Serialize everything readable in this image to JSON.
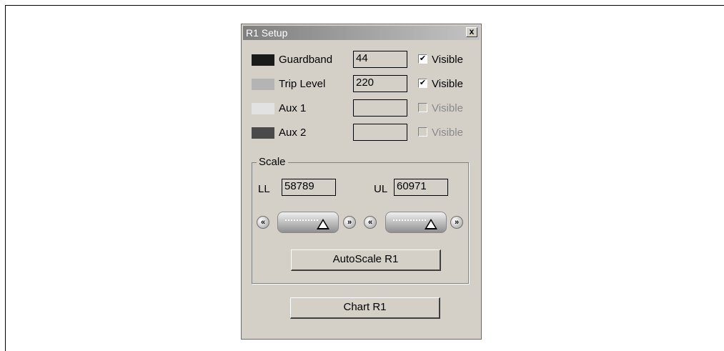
{
  "dialog": {
    "title": "R1 Setup",
    "close_glyph": "x"
  },
  "levels": [
    {
      "label": "Guardband",
      "color": "#1a1a1a",
      "value": "44",
      "visible_label": "Visible",
      "checked": true,
      "enabled": true
    },
    {
      "label": "Trip Level",
      "color": "#b4b4b4",
      "value": "220",
      "visible_label": "Visible",
      "checked": true,
      "enabled": true
    },
    {
      "label": "Aux 1",
      "color": "#e2e2e2",
      "value": "",
      "visible_label": "Visible",
      "checked": false,
      "enabled": false
    },
    {
      "label": "Aux 2",
      "color": "#4a4a4a",
      "value": "",
      "visible_label": "Visible",
      "checked": false,
      "enabled": false
    }
  ],
  "scale": {
    "legend": "Scale",
    "ll_label": "LL",
    "ll_value": "58789",
    "ul_label": "UL",
    "ul_value": "60971",
    "autoscale_label": "AutoScale R1"
  },
  "chart_button_label": "Chart R1",
  "check_glyph": "✔",
  "arrow_left_glyph": "«",
  "arrow_right_glyph": "»"
}
